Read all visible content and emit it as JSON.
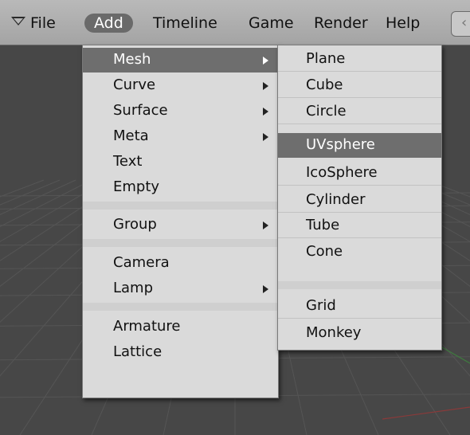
{
  "menubar": {
    "items": [
      "File",
      "Add",
      "Timeline",
      "Game",
      "Render",
      "Help"
    ],
    "partial_button_glyph": "‹"
  },
  "add_menu": {
    "items": [
      {
        "label": "Mesh",
        "submenu": true,
        "highlighted": true
      },
      {
        "label": "Curve",
        "submenu": true
      },
      {
        "label": "Surface",
        "submenu": true
      },
      {
        "label": "Meta",
        "submenu": true
      },
      {
        "label": "Text",
        "submenu": false
      },
      {
        "label": "Empty",
        "submenu": false
      },
      {
        "label": "Group",
        "submenu": true
      },
      {
        "label": "Camera",
        "submenu": false
      },
      {
        "label": "Lamp",
        "submenu": true
      },
      {
        "label": "Armature",
        "submenu": false
      },
      {
        "label": "Lattice",
        "submenu": false
      }
    ]
  },
  "mesh_menu": {
    "items": [
      {
        "label": "Plane"
      },
      {
        "label": "Cube"
      },
      {
        "label": "Circle"
      },
      {
        "label": "UVsphere",
        "highlighted": true
      },
      {
        "label": "IcoSphere"
      },
      {
        "label": "Cylinder"
      },
      {
        "label": "Tube"
      },
      {
        "label": "Cone"
      },
      {
        "label": "Grid"
      },
      {
        "label": "Monkey"
      }
    ]
  },
  "colors": {
    "menubar_bg": "#b0b0b0",
    "menu_bg": "#dadada",
    "highlight": "#6e6e6e",
    "viewport_bg": "#474747",
    "grid_line": "#555555",
    "axis_green": "#3f7a3f",
    "axis_red": "#8a3a3a"
  }
}
